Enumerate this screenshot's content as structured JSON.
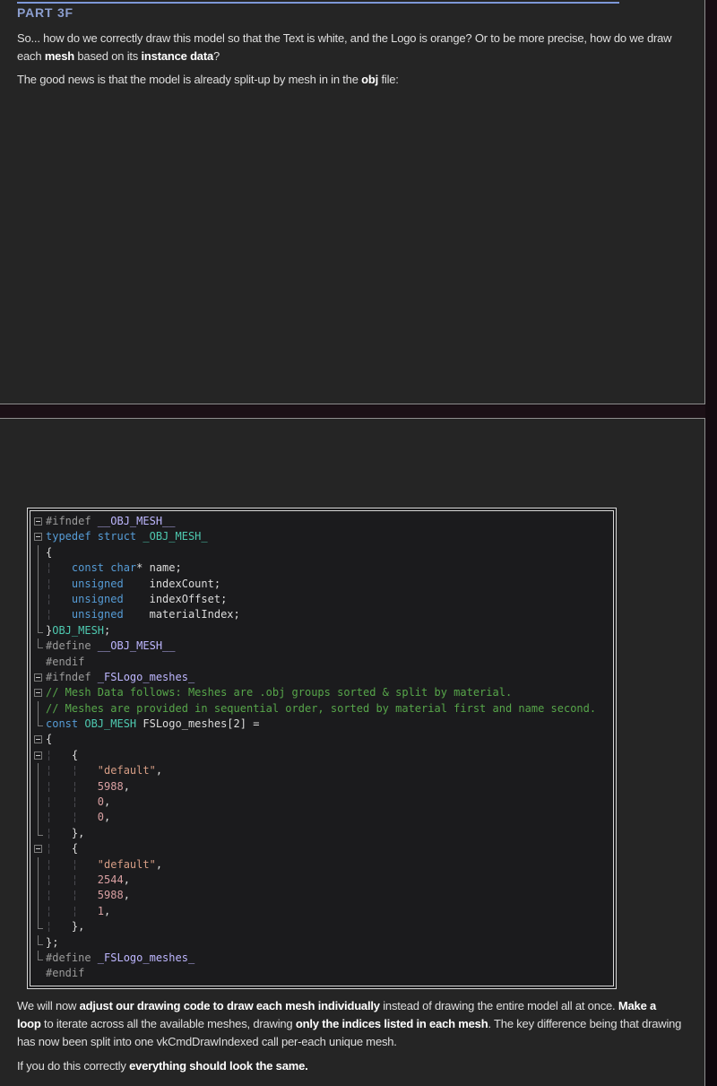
{
  "page": {
    "heading": "PART 3F",
    "paragraphs_top": [
      {
        "segments": [
          {
            "text": "So... how do we correctly draw this model so that the Text is white, and the Logo is orange? Or to be more precise, how do we draw each ",
            "bold": false
          },
          {
            "text": "mesh",
            "bold": true
          },
          {
            "text": " based on its ",
            "bold": false
          },
          {
            "text": "instance data",
            "bold": true
          },
          {
            "text": "?",
            "bold": false
          }
        ]
      },
      {
        "segments": [
          {
            "text": "The good news is that the model is already split-up by mesh in in the ",
            "bold": false
          },
          {
            "text": "obj",
            "bold": true
          },
          {
            "text": " file:",
            "bold": false
          }
        ]
      }
    ],
    "paragraphs_bottom": [
      {
        "segments": [
          {
            "text": "We will now ",
            "bold": false
          },
          {
            "text": "adjust our drawing code to draw each mesh individually",
            "bold": true
          },
          {
            "text": " instead of drawing the entire model all at once. ",
            "bold": false
          },
          {
            "text": "Make a loop",
            "bold": true
          },
          {
            "text": " to iterate across all the available meshes, drawing ",
            "bold": false
          },
          {
            "text": "only the indices listed in each mesh",
            "bold": true
          },
          {
            "text": ". The key difference being that drawing has now been split into one vkCmdDrawIndexed call per-each unique mesh.",
            "bold": false
          }
        ]
      },
      {
        "segments": [
          {
            "text": "If you do this correctly ",
            "bold": false
          },
          {
            "text": "everything should look the same.",
            "bold": true
          }
        ]
      }
    ]
  },
  "code_block": {
    "lines": [
      {
        "margin": "b",
        "tokens": [
          [
            "pp",
            "#ifndef "
          ],
          [
            "mac",
            "__OBJ_MESH__"
          ]
        ]
      },
      {
        "margin": "b",
        "tokens": [
          [
            "kw",
            "typedef struct "
          ],
          [
            "ty",
            "_OBJ_MESH_"
          ]
        ]
      },
      {
        "margin": "v",
        "tokens": [
          [
            "id",
            "{"
          ]
        ]
      },
      {
        "margin": "v",
        "tokens": [
          [
            "gd",
            "¦   "
          ],
          [
            "kw",
            "const char"
          ],
          [
            "id",
            "* name;"
          ]
        ]
      },
      {
        "margin": "v",
        "tokens": [
          [
            "gd",
            "¦   "
          ],
          [
            "kw",
            "unsigned"
          ],
          [
            "id",
            "    indexCount;"
          ]
        ]
      },
      {
        "margin": "v",
        "tokens": [
          [
            "gd",
            "¦   "
          ],
          [
            "kw",
            "unsigned"
          ],
          [
            "id",
            "    indexOffset;"
          ]
        ]
      },
      {
        "margin": "v",
        "tokens": [
          [
            "gd",
            "¦   "
          ],
          [
            "kw",
            "unsigned"
          ],
          [
            "id",
            "    materialIndex;"
          ]
        ]
      },
      {
        "margin": "c",
        "tokens": [
          [
            "id",
            "}"
          ],
          [
            "ty",
            "OBJ_MESH"
          ],
          [
            "id",
            ";"
          ]
        ]
      },
      {
        "margin": "c",
        "tokens": [
          [
            "pp",
            "#define "
          ],
          [
            "mac",
            "__OBJ_MESH__"
          ]
        ]
      },
      {
        "margin": "",
        "tokens": [
          [
            "pp",
            "#endif"
          ]
        ]
      },
      {
        "margin": "b",
        "tokens": [
          [
            "pp",
            "#ifndef "
          ],
          [
            "mac",
            "_FSLogo_meshes_"
          ]
        ]
      },
      {
        "margin": "b",
        "tokens": [
          [
            "cm",
            "// Mesh Data follows: Meshes are .obj groups sorted & split by material."
          ]
        ]
      },
      {
        "margin": "v",
        "tokens": [
          [
            "cm",
            "// Meshes are provided in sequential order, sorted by material first and name second."
          ]
        ]
      },
      {
        "margin": "c",
        "tokens": [
          [
            "kw",
            "const "
          ],
          [
            "ty",
            "OBJ_MESH"
          ],
          [
            "id",
            " FSLogo_meshes[2] ="
          ]
        ]
      },
      {
        "margin": "b",
        "tokens": [
          [
            "id",
            "{"
          ]
        ]
      },
      {
        "margin": "b",
        "tokens": [
          [
            "gd",
            "¦   "
          ],
          [
            "id",
            "{"
          ]
        ]
      },
      {
        "margin": "v",
        "tokens": [
          [
            "gd",
            "¦   ¦   "
          ],
          [
            "str",
            "\"default\""
          ],
          [
            "id",
            ","
          ]
        ]
      },
      {
        "margin": "v",
        "tokens": [
          [
            "gd",
            "¦   ¦   "
          ],
          [
            "num",
            "5988"
          ],
          [
            "id",
            ","
          ]
        ]
      },
      {
        "margin": "v",
        "tokens": [
          [
            "gd",
            "¦   ¦   "
          ],
          [
            "num",
            "0"
          ],
          [
            "id",
            ","
          ]
        ]
      },
      {
        "margin": "v",
        "tokens": [
          [
            "gd",
            "¦   ¦   "
          ],
          [
            "num",
            "0"
          ],
          [
            "id",
            ","
          ]
        ]
      },
      {
        "margin": "c",
        "tokens": [
          [
            "gd",
            "¦   "
          ],
          [
            "id",
            "},"
          ]
        ]
      },
      {
        "margin": "b",
        "tokens": [
          [
            "gd",
            "¦   "
          ],
          [
            "id",
            "{"
          ]
        ]
      },
      {
        "margin": "v",
        "tokens": [
          [
            "gd",
            "¦   ¦   "
          ],
          [
            "str",
            "\"default\""
          ],
          [
            "id",
            ","
          ]
        ]
      },
      {
        "margin": "v",
        "tokens": [
          [
            "gd",
            "¦   ¦   "
          ],
          [
            "num",
            "2544"
          ],
          [
            "id",
            ","
          ]
        ]
      },
      {
        "margin": "v",
        "tokens": [
          [
            "gd",
            "¦   ¦   "
          ],
          [
            "num",
            "5988"
          ],
          [
            "id",
            ","
          ]
        ]
      },
      {
        "margin": "v",
        "tokens": [
          [
            "gd",
            "¦   ¦   "
          ],
          [
            "num",
            "1"
          ],
          [
            "id",
            ","
          ]
        ]
      },
      {
        "margin": "c",
        "tokens": [
          [
            "gd",
            "¦   "
          ],
          [
            "id",
            "},"
          ]
        ]
      },
      {
        "margin": "c",
        "tokens": [
          [
            "id",
            "};"
          ]
        ]
      },
      {
        "margin": "c",
        "tokens": [
          [
            "pp",
            "#define "
          ],
          [
            "mac",
            "_FSLogo_meshes_"
          ]
        ]
      },
      {
        "margin": "",
        "tokens": [
          [
            "pp",
            "#endif"
          ]
        ]
      }
    ]
  },
  "colors": {
    "bg_outer_top": "#170D13",
    "bg_outer_bottom": "#0D070C",
    "bg_gap": "#1B1016",
    "bg_panel": "#252525",
    "border_panel": "#8F8F8F",
    "rule_blue": "#7D97D8",
    "heading_blue": "#8C9FD0",
    "text_normal": "#DFDFDF",
    "text_bold": "#FFFFFF",
    "code_bg": "#1B1B1D",
    "code_border": "#D8D8D8",
    "fold": "#7A7A7A",
    "fold_bright": "#C8C8C8",
    "tok_pp": "#9B9B9B",
    "tok_mac": "#BEB7FF",
    "tok_kw": "#569CD6",
    "tok_ty": "#4EC9B0",
    "tok_id": "#DCDCDC",
    "tok_cm": "#57A64A",
    "tok_str": "#D69D85",
    "tok_num": "#D9A0A2",
    "tok_gd": "#4B4B51"
  }
}
